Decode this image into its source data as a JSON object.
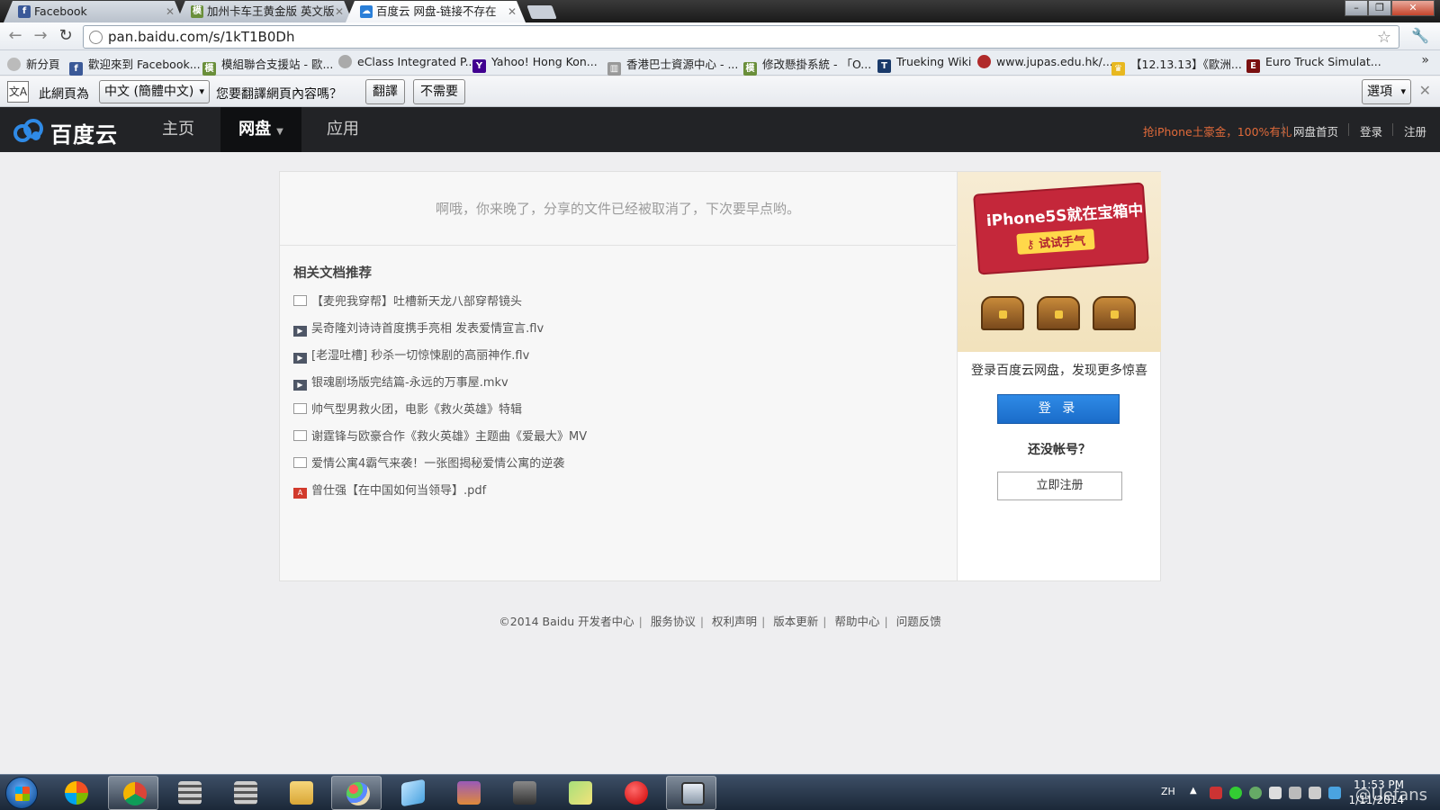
{
  "browser": {
    "tabs": [
      {
        "title": "Facebook",
        "icon": "facebook-icon",
        "active": false
      },
      {
        "title": "加州卡车王黄金版 英文版",
        "icon": "forum-icon",
        "active": false
      },
      {
        "title": "百度云 网盘-链接不存在",
        "icon": "baidu-cloud-icon",
        "active": true
      }
    ],
    "url": "pan.baidu.com/s/1kT1B0Dh",
    "window_buttons": {
      "minimize": "–",
      "restore": "❐",
      "close": "✕"
    },
    "bookmarks": [
      {
        "label": "新分頁",
        "icon": "new-page-icon"
      },
      {
        "label": "歡迎來到 Facebook...",
        "icon": "facebook-icon"
      },
      {
        "label": "模組聯合支援站 - 歐...",
        "icon": "forum-icon"
      },
      {
        "label": "eClass Integrated P...",
        "icon": "globe-icon"
      },
      {
        "label": "Yahoo! Hong Kon...",
        "icon": "yahoo-icon"
      },
      {
        "label": "香港巴士資源中心 - ...",
        "icon": "bus-icon"
      },
      {
        "label": "修改懸掛系統 - 「O...",
        "icon": "forum-icon"
      },
      {
        "label": "Trueking Wiki",
        "icon": "wiki-icon"
      },
      {
        "label": "www.jupas.edu.hk/...",
        "icon": "jupas-icon"
      },
      {
        "label": "【12.13.13】《歐洲...",
        "icon": "trophy-icon"
      },
      {
        "label": "Euro Truck Simulat...",
        "icon": "game-icon"
      }
    ],
    "translate_bar": {
      "prefix": "此網頁為",
      "language": "中文 (簡體中文)",
      "question": "您要翻譯網頁內容嗎？",
      "translate_button": "翻譯",
      "decline_button": "不需要",
      "options_button": "選項"
    }
  },
  "header": {
    "logo_text": "百度云",
    "nav": [
      {
        "label": "主页",
        "active": false
      },
      {
        "label": "网盘",
        "active": true
      },
      {
        "label": "应用",
        "active": false
      }
    ],
    "promo_link": "抢iPhone土豪金，100%有礼",
    "links": [
      "网盘首页",
      "登录",
      "注册"
    ]
  },
  "main": {
    "notice": "啊哦，你来晚了，分享的文件已经被取消了，下次要早点哟。",
    "recommend_title": "相关文档推荐",
    "documents": [
      {
        "title": "【麦兜我穿帮】吐槽新天龙八部穿帮镜头",
        "type": "doc"
      },
      {
        "title": "吴奇隆刘诗诗首度携手亮相 发表爱情宣言.flv",
        "type": "video"
      },
      {
        "title": "[老湿吐槽] 秒杀一切惊悚剧的高丽神作.flv",
        "type": "video"
      },
      {
        "title": "银魂剧场版完结篇-永远的万事屋.mkv",
        "type": "video"
      },
      {
        "title": "帅气型男救火团，电影《救火英雄》特辑",
        "type": "doc"
      },
      {
        "title": "谢霆锋与欧豪合作《救火英雄》主题曲《爱最大》MV",
        "type": "doc"
      },
      {
        "title": "爱情公寓4霸气来袭！一张图揭秘爱情公寓的逆袭",
        "type": "doc"
      },
      {
        "title": "曾仕强【在中国如何当领导】.pdf",
        "type": "pdf"
      }
    ]
  },
  "sidebar": {
    "banner_headline": "iPhone5S就在宝箱中",
    "banner_button": "试试手气",
    "tagline": "登录百度云网盘，发现更多惊喜",
    "login_button": "登 录",
    "no_account": "还没帐号？",
    "register_button": "立即注册"
  },
  "footer": {
    "copyright": "©2014 Baidu",
    "links": [
      "开发者中心",
      "服务协议",
      "权利声明",
      "版本更新",
      "帮助中心",
      "问题反馈"
    ]
  },
  "taskbar": {
    "apps": [
      "explorer-icon",
      "chrome-icon",
      "calculator-icon",
      "calculator-icon",
      "folder-icon",
      "paint-icon",
      "notepad-icon",
      "winrar-icon",
      "truck-game-icon",
      "folder-icon",
      "record-icon",
      "monitor-icon"
    ],
    "language": "ZH",
    "time": "11:53 PM",
    "date": "1/11/2014",
    "watermark": "@Uefans"
  },
  "colors": {
    "header_bg": "#222326",
    "login_blue": "#1a6cc9",
    "promo_orange": "#e06a3a",
    "pdf_red": "#d23a2c"
  }
}
